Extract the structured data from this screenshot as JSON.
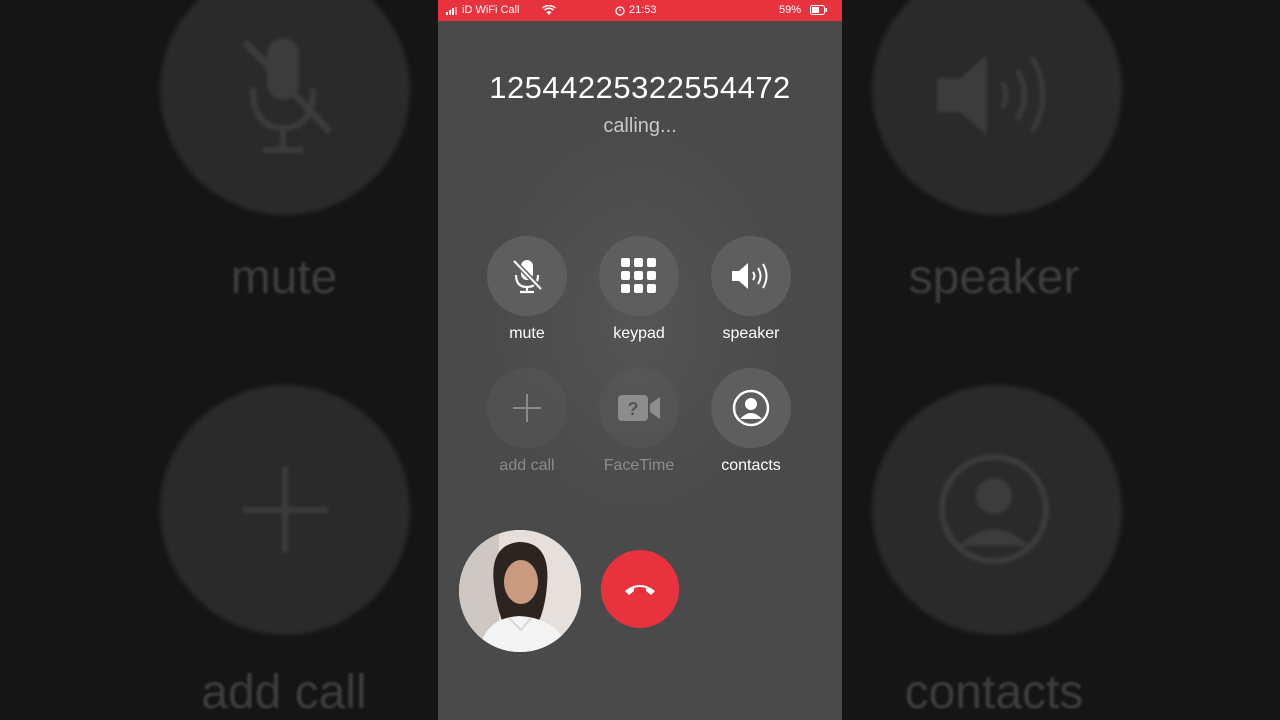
{
  "status": {
    "carrier": "iD WiFi Call",
    "time": "21:53",
    "battery": "59%"
  },
  "call": {
    "number": "12544225322554472",
    "status": "calling..."
  },
  "controls": {
    "mute": "mute",
    "keypad": "keypad",
    "speaker": "speaker",
    "add_call": "add call",
    "facetime": "FaceTime",
    "contacts": "contacts"
  },
  "background": {
    "left_top_label": "mute",
    "left_bottom_label": "add call",
    "right_top_label": "speaker",
    "right_bottom_label": "contacts"
  },
  "colors": {
    "accent": "#e8333f",
    "phone_bg": "#4a4a4a",
    "button_bg": "#5e5e5e"
  }
}
